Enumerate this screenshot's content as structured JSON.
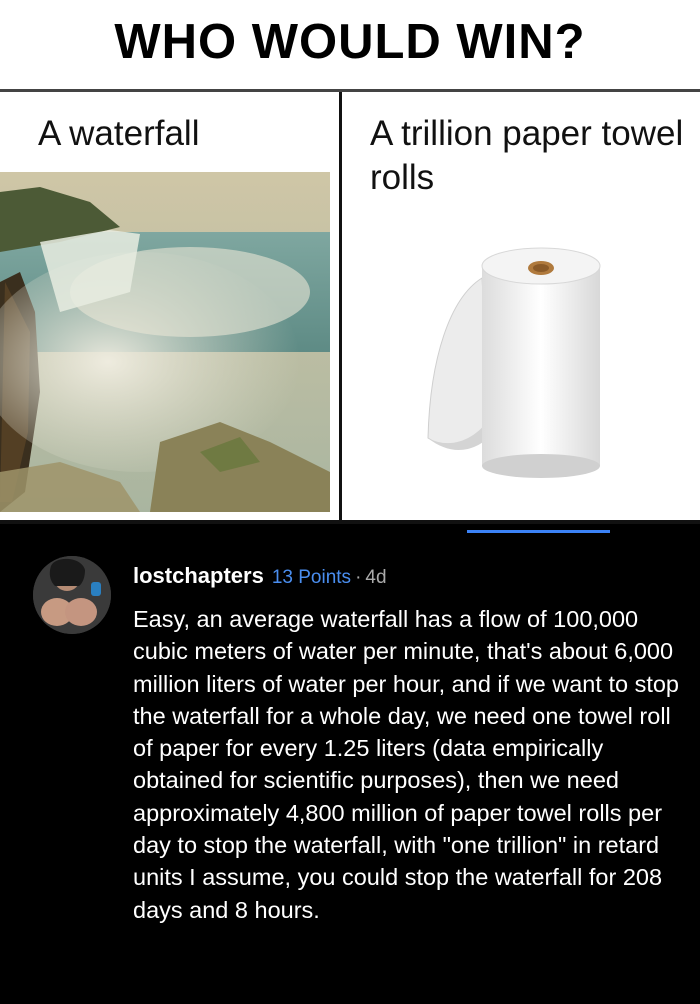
{
  "meme": {
    "title": "WHO WOULD WIN?",
    "left_label": "A waterfall",
    "right_label": "A trillion paper towel rolls"
  },
  "comment": {
    "username": "lostchapters",
    "points": "13 Points",
    "separator": "·",
    "age": "4d",
    "body": "Easy, an average waterfall has a flow of 100,000 cubic meters of water per minute, that's about 6,000 million liters of water per hour, and if we want to stop the waterfall for a whole day, we need one towel roll of paper for every 1.25 liters (data empirically obtained for scientific purposes), then we need approximately 4,800 million of paper towel rolls per day to stop the waterfall, with \"one trillion\" in retard units I assume, you could stop the waterfall for 208 days and 8 hours."
  },
  "colors": {
    "background": "#000000",
    "points": "#4a8ef0",
    "tab_indicator": "#3b82f6"
  }
}
